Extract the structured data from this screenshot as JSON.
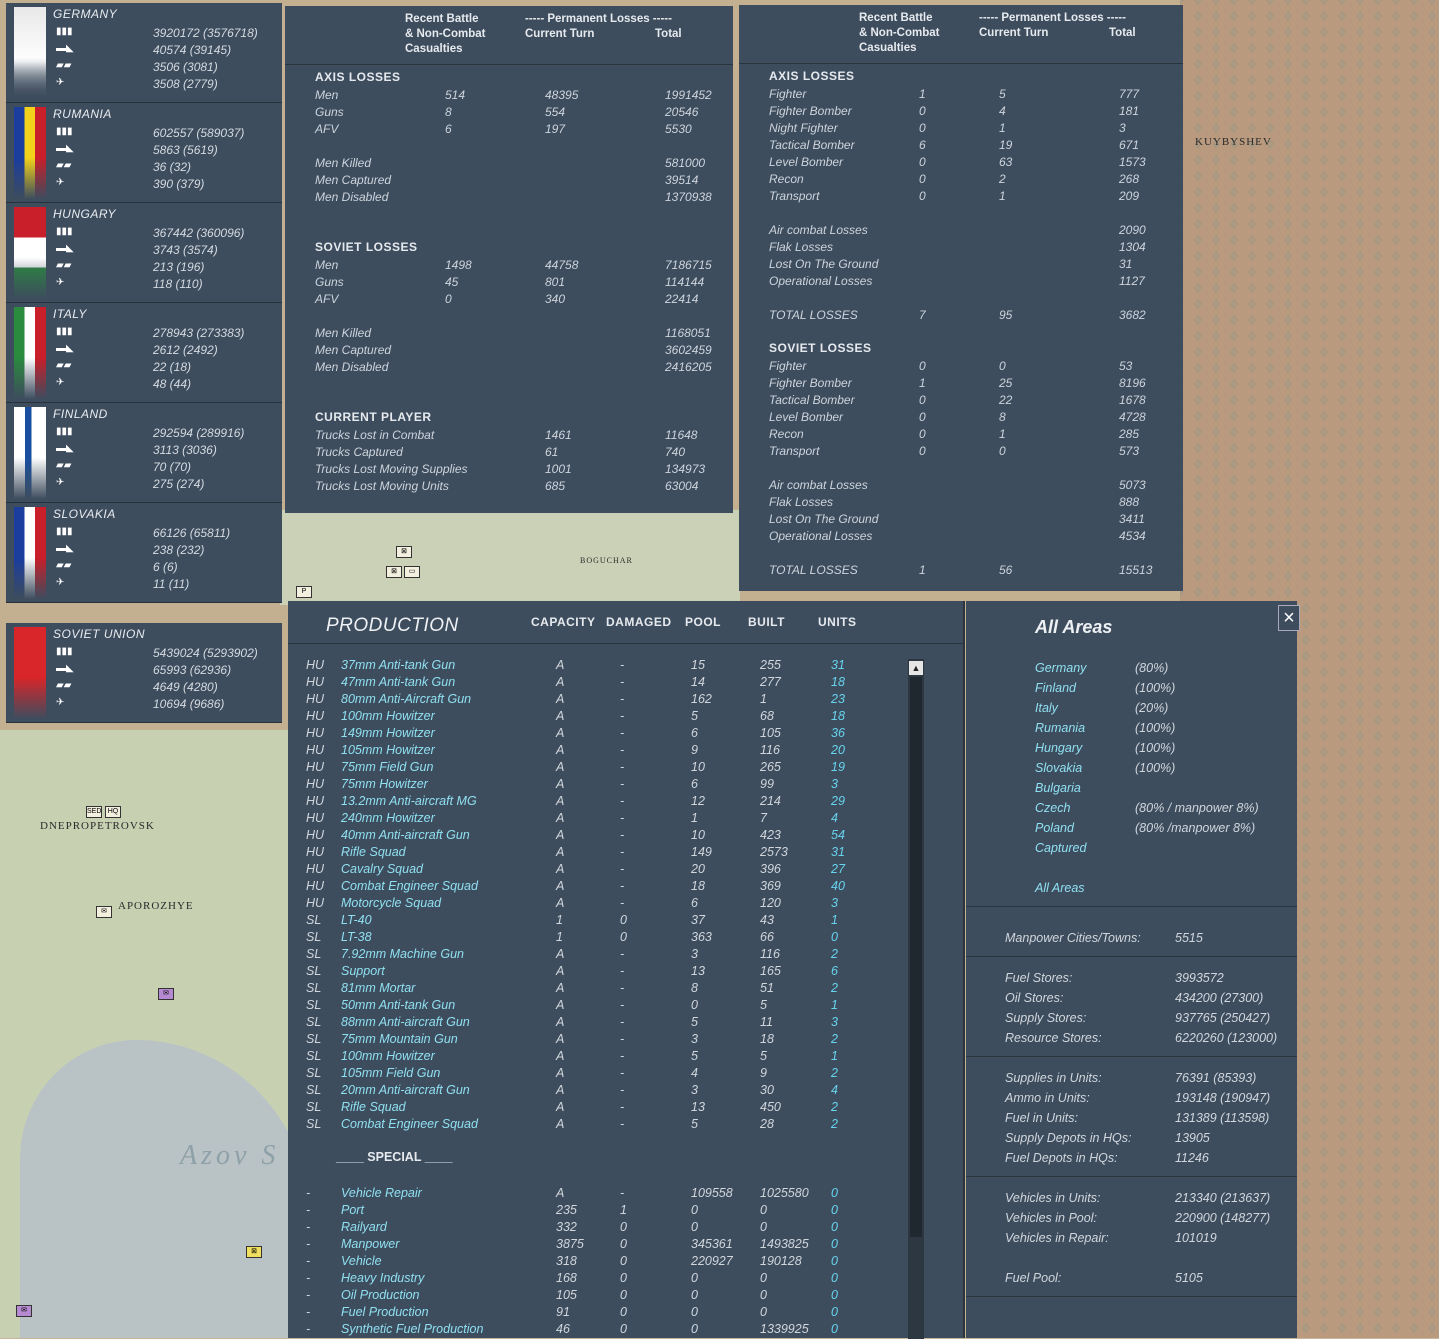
{
  "map": {
    "labels": [
      "KUYBYSHEV",
      "DNEPROPETROVSK",
      "APOROZHYE",
      "BOGUCHAR",
      "Azov S"
    ]
  },
  "countries": [
    {
      "name": "GERMANY",
      "men": "3920172 (3576718)",
      "guns": "40574 (39145)",
      "afv": "3506 (3081)",
      "air": "3508 (2779)"
    },
    {
      "name": "RUMANIA",
      "men": "602557 (589037)",
      "guns": "5863 (5619)",
      "afv": "36 (32)",
      "air": "390 (379)"
    },
    {
      "name": "HUNGARY",
      "men": "367442 (360096)",
      "guns": "3743 (3574)",
      "afv": "213 (196)",
      "air": "118 (110)"
    },
    {
      "name": "ITALY",
      "men": "278943 (273383)",
      "guns": "2612 (2492)",
      "afv": "22 (18)",
      "air": "48 (44)"
    },
    {
      "name": "FINLAND",
      "men": "292594 (289916)",
      "guns": "3113 (3036)",
      "afv": "70 (70)",
      "air": "275 (274)"
    },
    {
      "name": "SLOVAKIA",
      "men": "66126 (65811)",
      "guns": "238 (232)",
      "afv": "6 (6)",
      "air": "11 (11)"
    },
    {
      "name": "SOVIET UNION",
      "men": "5439024 (5293902)",
      "guns": "65993 (62936)",
      "afv": "4649 (4280)",
      "air": "10694 (9686)"
    }
  ],
  "ground_losses": {
    "hdr_recent": "Recent Battle\n& Non-Combat\nCasualties",
    "hdr_perm": "----- Permanent Losses -----",
    "hdr_cur": "Current Turn",
    "hdr_total": "Total",
    "axis_title": "AXIS LOSSES",
    "axis_rows": [
      [
        "Men",
        "514",
        "48395",
        "1991452"
      ],
      [
        "Guns",
        "8",
        "554",
        "20546"
      ],
      [
        "AFV",
        "6",
        "197",
        "5530"
      ]
    ],
    "axis_detail": [
      [
        "Men Killed",
        "581000"
      ],
      [
        "Men Captured",
        "39514"
      ],
      [
        "Men Disabled",
        "1370938"
      ]
    ],
    "soviet_title": "SOVIET LOSSES",
    "soviet_rows": [
      [
        "Men",
        "1498",
        "44758",
        "7186715"
      ],
      [
        "Guns",
        "45",
        "801",
        "114144"
      ],
      [
        "AFV",
        "0",
        "340",
        "22414"
      ]
    ],
    "soviet_detail": [
      [
        "Men Killed",
        "1168051"
      ],
      [
        "Men Captured",
        "3602459"
      ],
      [
        "Men Disabled",
        "2416205"
      ]
    ],
    "player_title": "CURRENT PLAYER",
    "player_rows": [
      [
        "Trucks Lost in Combat",
        "1461",
        "11648"
      ],
      [
        "Trucks Captured",
        "61",
        "740"
      ],
      [
        "Trucks Lost Moving Supplies",
        "1001",
        "134973"
      ],
      [
        "Trucks Lost Moving Units",
        "685",
        "63004"
      ]
    ]
  },
  "air_losses": {
    "hdr_recent": "Recent Battle\n& Non-Combat\nCasualties",
    "hdr_perm": "----- Permanent Losses -----",
    "hdr_cur": "Current Turn",
    "hdr_total": "Total",
    "axis_title": "AXIS LOSSES",
    "axis_rows": [
      [
        "Fighter",
        "1",
        "5",
        "777"
      ],
      [
        "Fighter Bomber",
        "0",
        "4",
        "181"
      ],
      [
        "Night Fighter",
        "0",
        "1",
        "3"
      ],
      [
        "Tactical Bomber",
        "6",
        "19",
        "671"
      ],
      [
        "Level Bomber",
        "0",
        "63",
        "1573"
      ],
      [
        "Recon",
        "0",
        "2",
        "268"
      ],
      [
        "Transport",
        "0",
        "1",
        "209"
      ]
    ],
    "axis_detail": [
      [
        "Air combat Losses",
        "2090"
      ],
      [
        "Flak Losses",
        "1304"
      ],
      [
        "Lost On The Ground",
        "31"
      ],
      [
        "Operational Losses",
        "1127"
      ]
    ],
    "axis_total": [
      "TOTAL LOSSES",
      "7",
      "95",
      "3682"
    ],
    "soviet_title": "SOVIET LOSSES",
    "soviet_rows": [
      [
        "Fighter",
        "0",
        "0",
        "53"
      ],
      [
        "Fighter Bomber",
        "1",
        "25",
        "8196"
      ],
      [
        "Tactical Bomber",
        "0",
        "22",
        "1678"
      ],
      [
        "Level Bomber",
        "0",
        "8",
        "4728"
      ],
      [
        "Recon",
        "0",
        "1",
        "285"
      ],
      [
        "Transport",
        "0",
        "0",
        "573"
      ]
    ],
    "soviet_detail": [
      [
        "Air combat Losses",
        "5073"
      ],
      [
        "Flak Losses",
        "888"
      ],
      [
        "Lost On The Ground",
        "3411"
      ],
      [
        "Operational Losses",
        "4534"
      ]
    ],
    "soviet_total": [
      "TOTAL LOSSES",
      "1",
      "56",
      "15513"
    ]
  },
  "production": {
    "title": "PRODUCTION",
    "cols": [
      "CAPACITY",
      "DAMAGED",
      "POOL",
      "BUILT",
      "UNITS"
    ],
    "rows": [
      [
        "HU",
        "37mm Anti-tank Gun",
        "A",
        "-",
        "15",
        "255",
        "31"
      ],
      [
        "HU",
        "47mm Anti-tank Gun",
        "A",
        "-",
        "14",
        "277",
        "18"
      ],
      [
        "HU",
        "80mm Anti-Aircraft Gun",
        "A",
        "-",
        "162",
        "1",
        "23"
      ],
      [
        "HU",
        "100mm Howitzer",
        "A",
        "-",
        "5",
        "68",
        "18"
      ],
      [
        "HU",
        "149mm Howitzer",
        "A",
        "-",
        "6",
        "105",
        "36"
      ],
      [
        "HU",
        "105mm Howitzer",
        "A",
        "-",
        "9",
        "116",
        "20"
      ],
      [
        "HU",
        "75mm Field Gun",
        "A",
        "-",
        "10",
        "265",
        "19"
      ],
      [
        "HU",
        "75mm Howitzer",
        "A",
        "-",
        "6",
        "99",
        "3"
      ],
      [
        "HU",
        "13.2mm Anti-aircraft MG",
        "A",
        "-",
        "12",
        "214",
        "29"
      ],
      [
        "HU",
        "240mm Howitzer",
        "A",
        "-",
        "1",
        "7",
        "4"
      ],
      [
        "HU",
        "40mm Anti-aircraft Gun",
        "A",
        "-",
        "10",
        "423",
        "54"
      ],
      [
        "HU",
        "Rifle Squad",
        "A",
        "-",
        "149",
        "2573",
        "31"
      ],
      [
        "HU",
        "Cavalry Squad",
        "A",
        "-",
        "20",
        "396",
        "27"
      ],
      [
        "HU",
        "Combat Engineer Squad",
        "A",
        "-",
        "18",
        "369",
        "40"
      ],
      [
        "HU",
        "Motorcycle Squad",
        "A",
        "-",
        "6",
        "120",
        "3"
      ],
      [
        "SL",
        "LT-40",
        "1",
        "0",
        "37",
        "43",
        "1"
      ],
      [
        "SL",
        "LT-38",
        "1",
        "0",
        "363",
        "66",
        "0"
      ],
      [
        "SL",
        "7.92mm Machine Gun",
        "A",
        "-",
        "3",
        "116",
        "2"
      ],
      [
        "SL",
        "Support",
        "A",
        "-",
        "13",
        "165",
        "6"
      ],
      [
        "SL",
        "81mm Mortar",
        "A",
        "-",
        "8",
        "51",
        "2"
      ],
      [
        "SL",
        "50mm Anti-tank Gun",
        "A",
        "-",
        "0",
        "5",
        "1"
      ],
      [
        "SL",
        "88mm Anti-aircraft Gun",
        "A",
        "-",
        "5",
        "11",
        "3"
      ],
      [
        "SL",
        "75mm Mountain Gun",
        "A",
        "-",
        "3",
        "18",
        "2"
      ],
      [
        "SL",
        "100mm Howitzer",
        "A",
        "-",
        "5",
        "5",
        "1"
      ],
      [
        "SL",
        "105mm Field Gun",
        "A",
        "-",
        "4",
        "9",
        "2"
      ],
      [
        "SL",
        "20mm Anti-aircraft Gun",
        "A",
        "-",
        "3",
        "30",
        "4"
      ],
      [
        "SL",
        "Rifle Squad",
        "A",
        "-",
        "13",
        "450",
        "2"
      ],
      [
        "SL",
        "Combat Engineer Squad",
        "A",
        "-",
        "5",
        "28",
        "2"
      ]
    ],
    "special_title": "____ SPECIAL ____",
    "special_rows": [
      [
        "-",
        "Vehicle Repair",
        "A",
        "-",
        "109558",
        "1025580",
        "0"
      ],
      [
        "-",
        "Port",
        "235",
        "1",
        "0",
        "0",
        "0"
      ],
      [
        "-",
        "Railyard",
        "332",
        "0",
        "0",
        "0",
        "0"
      ],
      [
        "-",
        "Manpower",
        "3875",
        "0",
        "345361",
        "1493825",
        "0"
      ],
      [
        "-",
        "Vehicle",
        "318",
        "0",
        "220927",
        "190128",
        "0"
      ],
      [
        "-",
        "Heavy Industry",
        "168",
        "0",
        "0",
        "0",
        "0"
      ],
      [
        "-",
        "Oil Production",
        "105",
        "0",
        "0",
        "0",
        "0"
      ],
      [
        "-",
        "Fuel Production",
        "91",
        "0",
        "0",
        "0",
        "0"
      ],
      [
        "-",
        "Synthetic Fuel Production",
        "46",
        "0",
        "0",
        "1339925",
        "0"
      ]
    ]
  },
  "areas": {
    "title": "All Areas",
    "close": "×",
    "list": [
      [
        "Germany",
        "(80%)"
      ],
      [
        "Finland",
        "(100%)"
      ],
      [
        "Italy",
        "(20%)"
      ],
      [
        "Rumania",
        "(100%)"
      ],
      [
        "Hungary",
        "(100%)"
      ],
      [
        "Slovakia",
        "(100%)"
      ],
      [
        "Bulgaria",
        ""
      ],
      [
        "Czech",
        "(80% / manpower 8%)"
      ],
      [
        "Poland",
        "(80% /manpower 8%)"
      ],
      [
        "Captured",
        ""
      ]
    ],
    "all": "All Areas",
    "manpower": [
      "Manpower Cities/Towns:",
      "5515"
    ],
    "stores": [
      [
        "Fuel Stores:",
        "3993572"
      ],
      [
        "Oil Stores:",
        "434200 (27300)"
      ],
      [
        "Supply Stores:",
        "937765 (250427)"
      ],
      [
        "Resource Stores:",
        "6220260 (123000)"
      ]
    ],
    "units": [
      [
        "Supplies in Units:",
        "76391 (85393)"
      ],
      [
        "Ammo in Units:",
        "193148 (190947)"
      ],
      [
        "Fuel in Units:",
        "131389 (113598)"
      ],
      [
        "Supply Depots in HQs:",
        "13905"
      ],
      [
        "Fuel Depots in HQs:",
        "11246"
      ]
    ],
    "vehicles": [
      [
        "Vehicles in Units:",
        "213340 (213637)"
      ],
      [
        "Vehicles in Pool:",
        "220900 (148277)"
      ],
      [
        "Vehicles in Repair:",
        "101019"
      ]
    ],
    "fuelpool": [
      "Fuel Pool:",
      "5105"
    ]
  },
  "colors": {
    "panel": "#3e4d5e",
    "unitName": "#8fe0f0",
    "unitCount": "#67d4ee"
  }
}
